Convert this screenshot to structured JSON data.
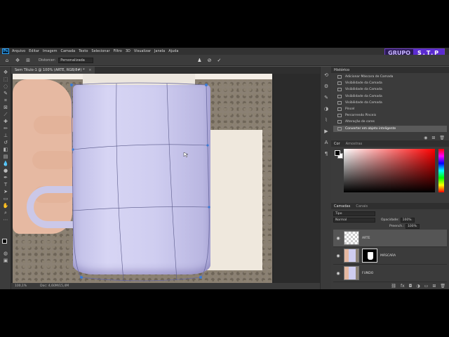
{
  "menubar": {
    "logo": "Ps",
    "items": [
      "Arquivo",
      "Editar",
      "Imagem",
      "Camada",
      "Texto",
      "Selecionar",
      "Filtro",
      "3D",
      "Visualizar",
      "Janela",
      "Ajuda"
    ]
  },
  "badge": {
    "left": "GRUPO",
    "right": "S.T.P"
  },
  "options": {
    "label": "Distorcer:",
    "select_value": "Personalizada",
    "icons": [
      "home-icon",
      "move-icon",
      "warp-split-icon"
    ]
  },
  "document": {
    "tab_title": "Sem Título-1 @ 100% (ARTE, RGB/8#) *",
    "zoom": "100,1%",
    "doc_info": "Doc: 4,60M/15,4M"
  },
  "history": {
    "title": "Histórico",
    "items": [
      "Adicionar Máscara de Camada",
      "Visibilidade da Camada",
      "Visibilidade da Camada",
      "Visibilidade da Camada",
      "Visibilidade da Camada",
      "Pincel",
      "Percorrendo Pinceis",
      "Alteração de cores",
      "Converter em objeto inteligente"
    ],
    "active_index": 8
  },
  "color": {
    "tab_active": "Cor",
    "tab_other": "Amostras",
    "foreground": "#000000",
    "background": "#ffffff"
  },
  "layers": {
    "tab_active": "Camadas",
    "tab_other": "Canais",
    "filter_placeholder": "Tipo",
    "blend_mode": "Normal",
    "opacity_label": "Opacidade:",
    "opacity_value": "100%",
    "fill_label": "Preench.:",
    "fill_value": "100%",
    "items": [
      {
        "name": "ARTE",
        "active": true
      },
      {
        "name": "MÁSCARA",
        "active": false
      },
      {
        "name": "FUNDO",
        "active": false
      }
    ]
  },
  "colors": {
    "accent_purple": "#5b2bd1",
    "mug": "#cfcdf0",
    "panel_bg": "#3b3b3b"
  }
}
